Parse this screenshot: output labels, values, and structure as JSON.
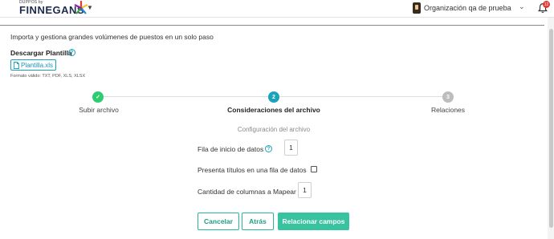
{
  "header": {
    "brand_small": "DUPPOS by",
    "brand_name": "FINNEGANS",
    "org_name": "Organización qa de prueba",
    "notification_count": "12"
  },
  "page": {
    "subtitle": "Importa y gestiona grandes volúmenes de puestos en un solo paso",
    "download_title": "Descargar Plantilla",
    "template_file": "Plantilla.xls",
    "formats": "Formato válido: TXT, PDF, XLS, XLSX"
  },
  "stepper": {
    "steps": [
      {
        "label": "Subir archivo",
        "state": "done"
      },
      {
        "label": "Consideraciones del archivo",
        "number": "2",
        "state": "active"
      },
      {
        "label": "Relaciones",
        "number": "3",
        "state": "pending"
      }
    ]
  },
  "config": {
    "title": "Configuración del archivo",
    "start_row_label": "Fila de inicio de datos",
    "start_row_value": "1",
    "titles_row_label": "Presenta títulos en una fila de datos",
    "titles_row_checked": false,
    "columns_label": "Cantidad de columnas a Mapear",
    "columns_value": "1"
  },
  "actions": {
    "cancel": "Cancelar",
    "back": "Atrás",
    "next": "Relacionar campos"
  },
  "colors": {
    "accent": "#1aa2bc",
    "success": "#2ecc71",
    "primary_button": "#37c3a0",
    "pending_step": "#bdbdbd"
  }
}
